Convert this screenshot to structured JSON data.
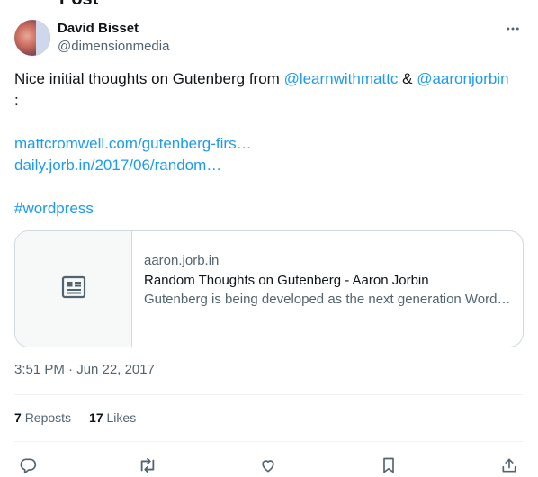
{
  "page": {
    "top_cut_text": "Post"
  },
  "author": {
    "name": "David Bisset",
    "handle": "@dimensionmedia"
  },
  "tweet": {
    "line1_prefix": "Nice initial thoughts on Gutenberg from ",
    "mention1": "@learnwithmattc",
    "amp": " & ",
    "mention2": "@aaronjorbin",
    "colon": ":",
    "link1": "mattcromwell.com/gutenberg-firs…",
    "link2": "daily.jorb.in/2017/06/random…",
    "hashtag": "#wordpress"
  },
  "card": {
    "domain": "aaron.jorb.in",
    "title": "Random Thoughts on Gutenberg - Aaron Jorbin",
    "description": "Gutenberg is being developed as the next generation WordPress editor. I made my first contribution earlier today to the project."
  },
  "meta": {
    "timestamp": "3:51 PM · Jun 22, 2017"
  },
  "stats": {
    "reposts_count": "7",
    "reposts_label": "Reposts",
    "likes_count": "17",
    "likes_label": "Likes"
  },
  "icons": {
    "more": "more-horizontal-icon",
    "article": "article-icon",
    "reply": "reply-icon",
    "repost": "repost-icon",
    "like": "like-icon",
    "bookmark": "bookmark-icon",
    "share": "share-icon"
  },
  "colors": {
    "link": "#1d9bf0",
    "text": "#0f1419",
    "secondary": "#536471",
    "border": "#cfd9de"
  }
}
